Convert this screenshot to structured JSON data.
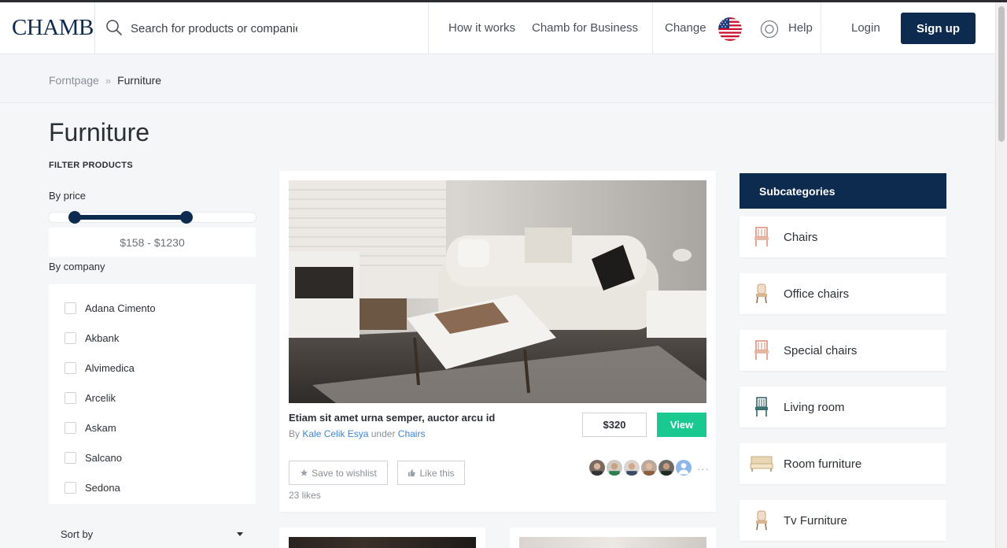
{
  "header": {
    "logo": "CHAMB",
    "search_placeholder": "Search for products or companies",
    "nav": {
      "how_it_works": "How it works",
      "for_business": "Chamb for Business",
      "change": "Change",
      "help": "Help",
      "login": "Login",
      "signup": "Sign up"
    }
  },
  "breadcrumb": {
    "home": "Forntpage",
    "separator": "»",
    "current": "Furniture"
  },
  "page_title": "Furniture",
  "filters": {
    "heading": "FILTER PRODUCTS",
    "by_price": "By price",
    "price_range": "$158 - $1230",
    "price_slider": {
      "low_fraction": 0.08,
      "high_fraction": 0.62
    },
    "by_company": "By company",
    "companies": [
      "Adana Cimento",
      "Akbank",
      "Alvimedica",
      "Arcelik",
      "Askam",
      "Salcano",
      "Sedona"
    ],
    "sort_by": "Sort by"
  },
  "product": {
    "title": "Etiam sit amet urna semper, auctor arcu id",
    "by_prefix": "By",
    "seller": "Kale Celik Esya",
    "under_word": "under",
    "category": "Chairs",
    "price": "$320",
    "view_label": "View",
    "save_label": "Save to wishlist",
    "like_label": "Like this",
    "likes": "23 likes",
    "more": "···"
  },
  "subcategories": {
    "heading": "Subcategories",
    "items": [
      {
        "label": "Chairs",
        "icon": "chair-icon"
      },
      {
        "label": "Office chairs",
        "icon": "office-chair-icon"
      },
      {
        "label": "Special chairs",
        "icon": "special-chair-icon"
      },
      {
        "label": "Living room",
        "icon": "living-room-icon"
      },
      {
        "label": "Room furniture",
        "icon": "bed-icon"
      },
      {
        "label": "Tv Furniture",
        "icon": "tv-furniture-icon"
      }
    ]
  },
  "colors": {
    "brand_navy": "#0d2b4f",
    "accent_green": "#19c98f",
    "link_blue": "#3b86d8"
  }
}
